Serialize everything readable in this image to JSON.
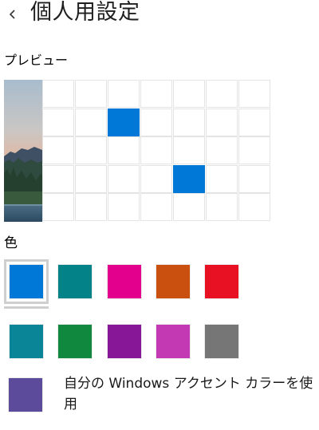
{
  "header": {
    "back_icon": "chevron-left-icon",
    "title": "個人用設定"
  },
  "preview": {
    "label": "プレビュー",
    "tile_color": "#ffffff",
    "accent_color": "#0078d7",
    "grid_rows": 5,
    "grid_cols": 7,
    "accent_tiles": [
      [
        1,
        2
      ],
      [
        3,
        4
      ]
    ]
  },
  "colors": {
    "label": "色",
    "selected_index": 0,
    "swatches": [
      {
        "name": "blue",
        "hex": "#0078d7"
      },
      {
        "name": "teal",
        "hex": "#038387"
      },
      {
        "name": "magenta",
        "hex": "#e3008c"
      },
      {
        "name": "orange",
        "hex": "#ca5010"
      },
      {
        "name": "red",
        "hex": "#e81123"
      },
      {
        "name": "dark-cyan",
        "hex": "#0a8497"
      },
      {
        "name": "green",
        "hex": "#10893e"
      },
      {
        "name": "purple",
        "hex": "#881798"
      },
      {
        "name": "orchid",
        "hex": "#c239b3"
      },
      {
        "name": "gray",
        "hex": "#767676"
      }
    ],
    "custom": {
      "label": "自分の Windows アクセント カラーを使用",
      "hex": "#5c4a9a"
    }
  }
}
